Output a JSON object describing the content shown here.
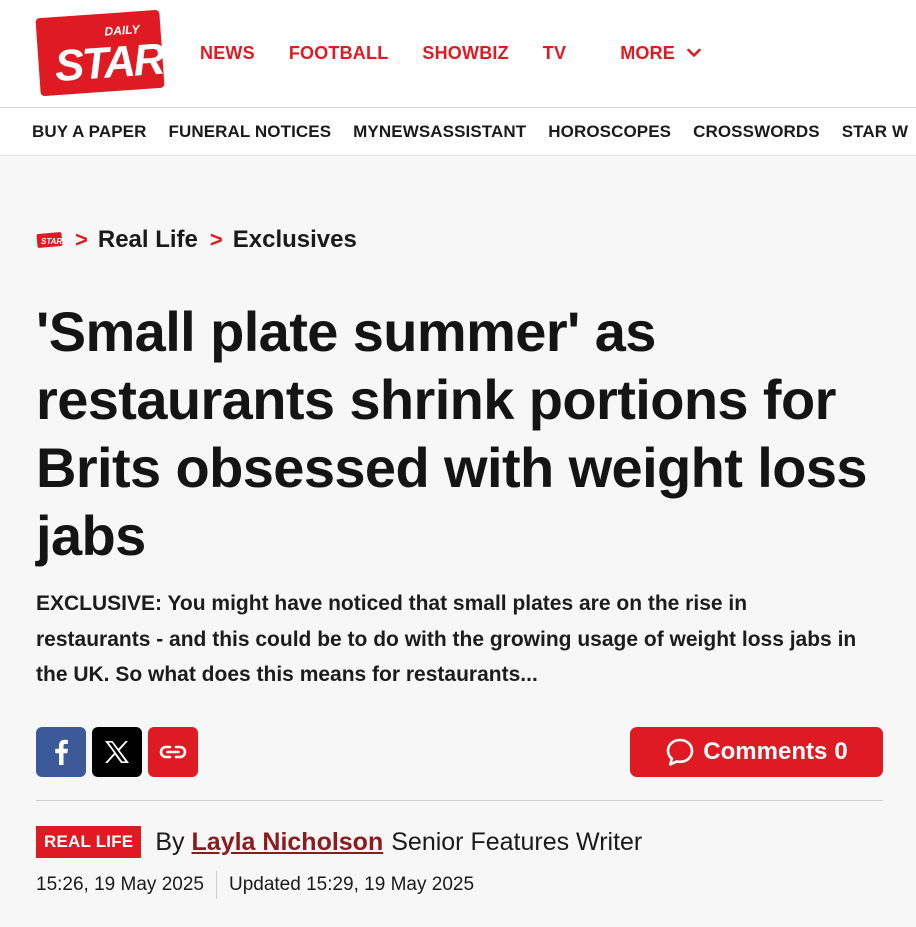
{
  "logo": {
    "brand": "DAILY STAR",
    "top_word": "DAILY",
    "main_word": "STAR"
  },
  "primary_nav": [
    {
      "label": "NEWS"
    },
    {
      "label": "FOOTBALL"
    },
    {
      "label": "SHOWBIZ"
    },
    {
      "label": "TV"
    }
  ],
  "more_label": "MORE",
  "secondary_nav": [
    {
      "label": "BUY A PAPER"
    },
    {
      "label": "FUNERAL NOTICES"
    },
    {
      "label": "MYNEWSASSISTANT"
    },
    {
      "label": "HOROSCOPES"
    },
    {
      "label": "CROSSWORDS"
    },
    {
      "label": "STAR W"
    }
  ],
  "breadcrumb": {
    "home_icon": "star-logo-icon",
    "items": [
      "Real Life",
      "Exclusives"
    ],
    "separator": ">"
  },
  "article": {
    "headline": "'Small plate summer' as restaurants shrink portions for Brits obsessed with weight loss jabs",
    "standfirst": "EXCLUSIVE: You might have noticed that small plates are on the rise in restaurants - and this could be to do with the growing usage of weight loss jabs in the UK. So what does this means for restaurants...",
    "section_badge": "REAL LIFE",
    "by_prefix": "By",
    "author": "Layla Nicholson",
    "author_role": "Senior Features Writer",
    "published": "15:26, 19 May 2025",
    "updated": "Updated 15:29, 19 May 2025"
  },
  "share": {
    "icons": [
      "facebook-icon",
      "x-icon",
      "link-icon"
    ]
  },
  "comments": {
    "label": "Comments",
    "count": "0",
    "icon": "speech-bubble-icon"
  },
  "colors": {
    "brand_red": "#e01a22",
    "facebook_blue": "#3b5998",
    "author_link": "#8b1c1c",
    "page_bg": "#f7f7f7"
  }
}
